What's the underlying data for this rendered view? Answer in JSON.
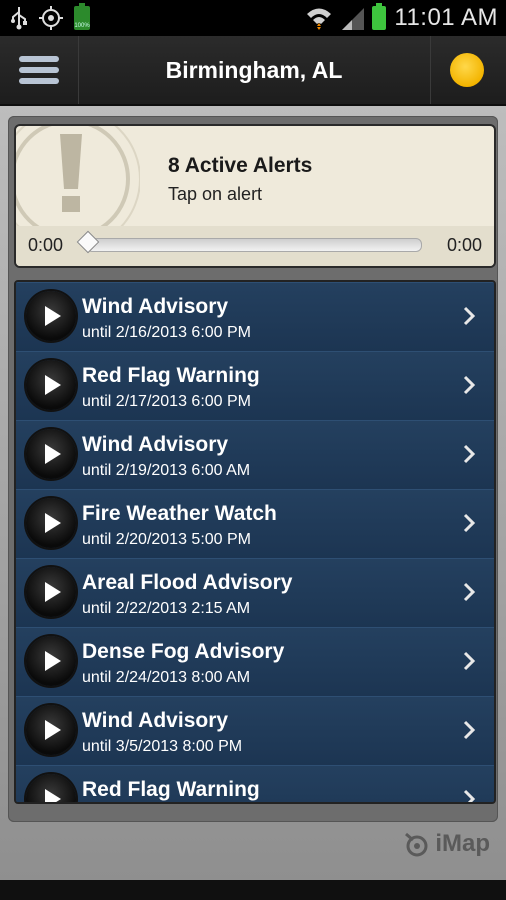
{
  "status_bar": {
    "time": "11:01 AM",
    "battery_small_label": "100%"
  },
  "header": {
    "city": "Birmingham, AL",
    "menu_icon": "hamburger-menu-icon",
    "weather_icon": "sun-icon"
  },
  "alert_panel": {
    "title": "8 Active Alerts",
    "subtitle": "Tap on alert",
    "time_start": "0:00",
    "time_end": "0:00",
    "progress": 0
  },
  "alerts": [
    {
      "title": "Wind Advisory",
      "until": "until 2/16/2013  6:00 PM"
    },
    {
      "title": "Red Flag Warning",
      "until": "until 2/17/2013  6:00 PM"
    },
    {
      "title": "Wind Advisory",
      "until": "until 2/19/2013  6:00 AM"
    },
    {
      "title": "Fire Weather Watch",
      "until": "until 2/20/2013  5:00 PM"
    },
    {
      "title": "Areal Flood Advisory",
      "until": "until 2/22/2013  2:15 AM"
    },
    {
      "title": "Dense Fog Advisory",
      "until": "until 2/24/2013  8:00 AM"
    },
    {
      "title": "Wind Advisory",
      "until": "until 3/5/2013  8:00 PM"
    },
    {
      "title": "Red Flag Warning",
      "until": ""
    }
  ],
  "footer": {
    "brand": "iMap"
  },
  "colors": {
    "list_bg": "#1d3550",
    "alert_panel_bg": "#efeadb",
    "sun": "#f3b400"
  }
}
